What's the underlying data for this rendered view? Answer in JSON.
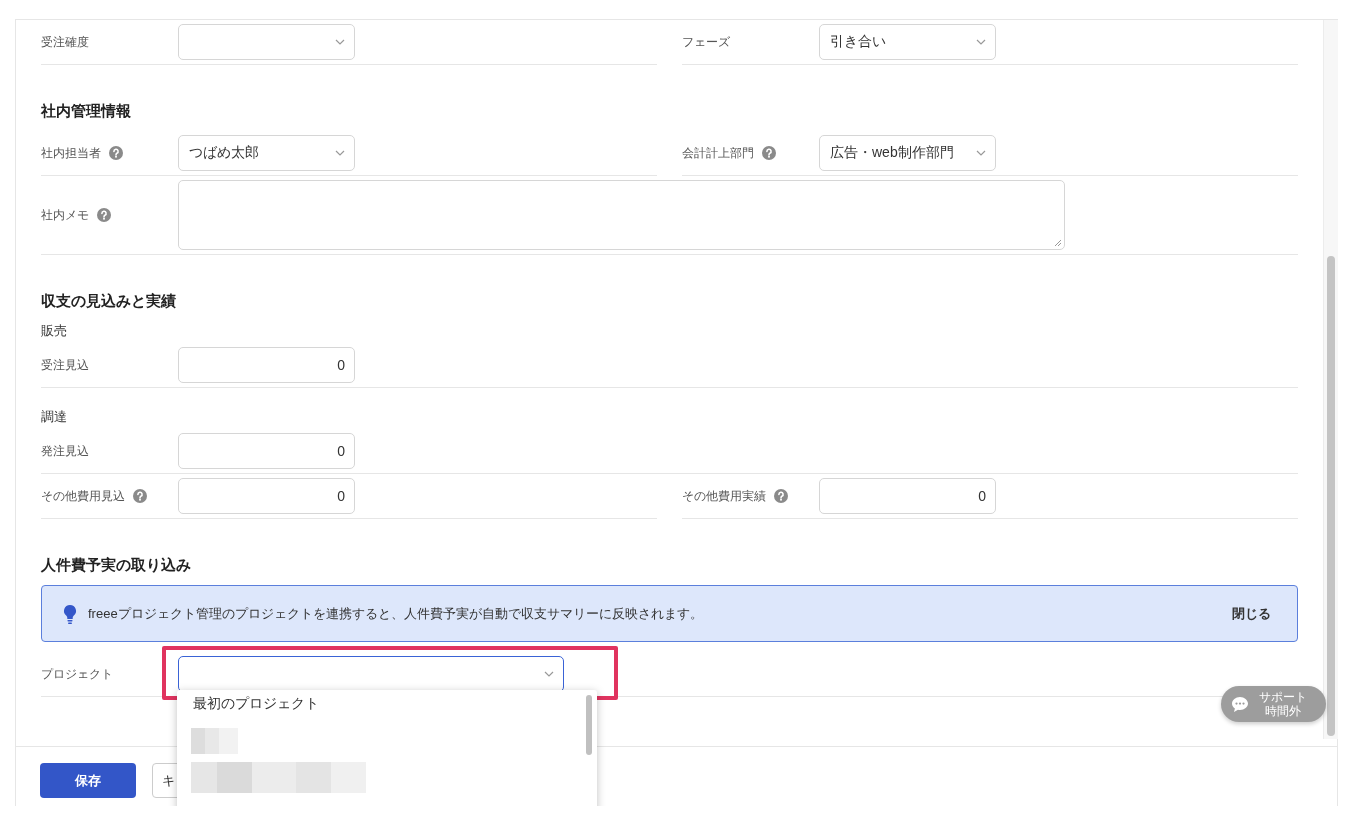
{
  "form": [
    {
      "kind": "row",
      "fields": [
        {
          "label": "受注確度",
          "kind": "select",
          "help": false
        },
        {
          "label": "フェーズ",
          "kind": "select",
          "help": false,
          "value": "引き合い"
        }
      ]
    },
    {
      "kind": "heading",
      "text": "社内管理情報"
    },
    {
      "kind": "row",
      "fields": [
        {
          "label": "社内担当者",
          "kind": "select",
          "help": true,
          "value": "つばめ太郎"
        },
        {
          "label": "会計計上部門",
          "kind": "select",
          "help": true,
          "value": "広告・web制作部門"
        }
      ]
    },
    {
      "kind": "row",
      "fields": [
        {
          "label": "社内メモ",
          "kind": "textarea",
          "help": true
        }
      ]
    },
    {
      "kind": "heading",
      "text": "収支の見込みと実績"
    },
    {
      "kind": "subheading",
      "text": "販売"
    },
    {
      "kind": "row",
      "fields": [
        {
          "label": "受注見込",
          "kind": "number",
          "help": false,
          "value": "0"
        }
      ]
    },
    {
      "kind": "subheading",
      "text": "調達"
    },
    {
      "kind": "row",
      "fields": [
        {
          "label": "発注見込",
          "kind": "number",
          "help": false,
          "value": "0"
        }
      ]
    },
    {
      "kind": "row",
      "fields": [
        {
          "label": "その他費用見込",
          "kind": "number",
          "help": true,
          "value": "0"
        },
        {
          "label": "その他費用実績",
          "kind": "number",
          "help": true,
          "value": "0"
        }
      ]
    },
    {
      "kind": "heading",
      "text": "人件費予実の取り込み"
    },
    {
      "kind": "banner",
      "text": "freeeプロジェクト管理のプロジェクトを連携すると、人件費予実が自動で収支サマリーに反映されます。",
      "close": "閉じる"
    },
    {
      "kind": "row",
      "fields": [
        {
          "label": "プロジェクト",
          "kind": "combobox",
          "help": false,
          "focused": true,
          "highlighted": true
        }
      ]
    }
  ],
  "dropdown": {
    "options": [
      {
        "kind": "text",
        "label": "最初のプロジェクト",
        "selected": false
      },
      {
        "kind": "redacted",
        "selected": false
      },
      {
        "kind": "redacted",
        "selected": false
      }
    ]
  },
  "actions": [
    {
      "kind": "primary",
      "label": "保存"
    },
    {
      "kind": "secondary",
      "label": "キ"
    }
  ],
  "support": {
    "lines": [
      "サポート",
      "時間外"
    ]
  }
}
